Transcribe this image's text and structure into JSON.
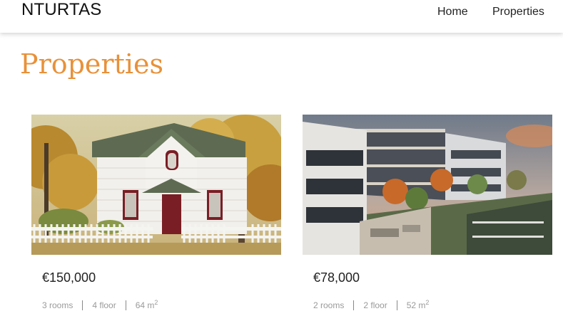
{
  "navbar": {
    "brand": "NTURTAS",
    "links": [
      "Home",
      "Properties"
    ]
  },
  "page": {
    "title": "Properties"
  },
  "listings": [
    {
      "price": "€150,000",
      "rooms": "3 rooms",
      "floor": "4 floor",
      "area": "64 m",
      "area_unit_sup": "2",
      "image": "white-house-photo"
    },
    {
      "price": "€78,000",
      "rooms": "2 rooms",
      "floor": "2 floor",
      "area": "52 m",
      "area_unit_sup": "2",
      "image": "apartment-complex-photo"
    }
  ],
  "colors": {
    "accent": "#e8913a"
  }
}
